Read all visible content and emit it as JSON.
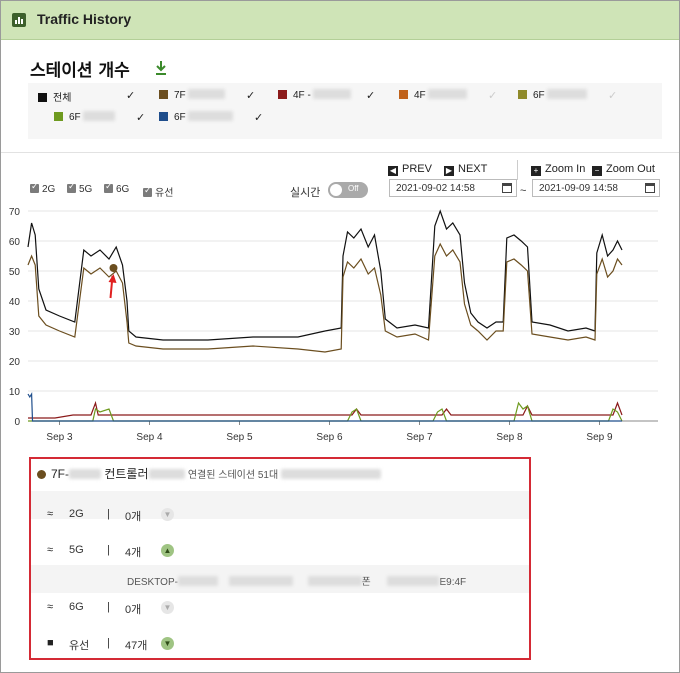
{
  "app": {
    "title": "Traffic History"
  },
  "section": {
    "title": "스테이션 개수"
  },
  "legend": [
    {
      "name": "전체",
      "color": "#111111",
      "checked": true
    },
    {
      "name": "7F",
      "color": "#6b4e1f",
      "checked": true,
      "blurred": true
    },
    {
      "name": "4F -",
      "color": "#8b1a1a",
      "checked": true,
      "blurred": true
    },
    {
      "name": "4F",
      "color": "#c0621b",
      "checked": false,
      "blurred": true
    },
    {
      "name": "6F",
      "color": "#8f8a2a",
      "checked": false,
      "blurred": true
    },
    {
      "name": "6F",
      "color": "#6e9a1f",
      "checked": true,
      "blurred": true
    },
    {
      "name": "6F",
      "color": "#1f4e8c",
      "checked": true,
      "blurred": true
    }
  ],
  "filters": {
    "bands": [
      "2G",
      "5G",
      "6G",
      "유선"
    ],
    "realtime_label": "실시간",
    "toggle": "Off"
  },
  "nav": {
    "prev": "PREV",
    "next": "NEXT",
    "zoom_in": "Zoom In",
    "zoom_out": "Zoom Out",
    "start": "2021-09-02 14:58",
    "end": "2021-09-09 14:58",
    "tilde": "~"
  },
  "chart_data": {
    "type": "line",
    "ylim": [
      0,
      70
    ],
    "yticks": [
      0,
      10,
      20,
      30,
      40,
      50,
      60,
      70
    ],
    "xlim": [
      0,
      7
    ],
    "xticks": [
      {
        "x": 0.35,
        "label": "Sep 3"
      },
      {
        "x": 1.35,
        "label": "Sep 4"
      },
      {
        "x": 2.35,
        "label": "Sep 5"
      },
      {
        "x": 3.35,
        "label": "Sep 6"
      },
      {
        "x": 4.35,
        "label": "Sep 7"
      },
      {
        "x": 5.35,
        "label": "Sep 8"
      },
      {
        "x": 6.35,
        "label": "Sep 9"
      }
    ],
    "grid": true,
    "marker": {
      "x": 0.95,
      "y": 51,
      "series": "7F"
    },
    "series": [
      {
        "name": "전체",
        "color": "#111111",
        "points": [
          [
            0,
            58
          ],
          [
            0.04,
            66
          ],
          [
            0.08,
            62
          ],
          [
            0.12,
            44
          ],
          [
            0.2,
            37
          ],
          [
            0.35,
            35
          ],
          [
            0.52,
            33
          ],
          [
            0.62,
            57
          ],
          [
            0.7,
            55
          ],
          [
            0.8,
            57
          ],
          [
            0.9,
            54
          ],
          [
            0.98,
            58
          ],
          [
            1.05,
            52
          ],
          [
            1.1,
            40
          ],
          [
            1.12,
            30
          ],
          [
            1.2,
            28
          ],
          [
            1.5,
            27
          ],
          [
            2,
            27
          ],
          [
            2.5,
            28
          ],
          [
            3,
            28
          ],
          [
            3.3,
            30
          ],
          [
            3.48,
            31
          ],
          [
            3.5,
            55
          ],
          [
            3.55,
            63
          ],
          [
            3.62,
            61
          ],
          [
            3.7,
            64
          ],
          [
            3.78,
            58
          ],
          [
            3.85,
            62
          ],
          [
            3.92,
            50
          ],
          [
            3.97,
            34
          ],
          [
            4.1,
            31
          ],
          [
            4.3,
            32
          ],
          [
            4.45,
            31
          ],
          [
            4.52,
            65
          ],
          [
            4.58,
            70
          ],
          [
            4.65,
            64
          ],
          [
            4.72,
            66
          ],
          [
            4.8,
            62
          ],
          [
            4.85,
            46
          ],
          [
            4.92,
            36
          ],
          [
            5,
            33
          ],
          [
            5.1,
            31
          ],
          [
            5.2,
            33
          ],
          [
            5.28,
            33
          ],
          [
            5.32,
            61
          ],
          [
            5.4,
            62
          ],
          [
            5.48,
            60
          ],
          [
            5.55,
            58
          ],
          [
            5.6,
            33
          ],
          [
            5.8,
            32
          ],
          [
            6,
            30
          ],
          [
            6.2,
            31
          ],
          [
            6.3,
            30
          ],
          [
            6.32,
            56
          ],
          [
            6.38,
            62
          ],
          [
            6.44,
            55
          ],
          [
            6.5,
            57
          ],
          [
            6.55,
            60
          ],
          [
            6.6,
            57
          ]
        ]
      },
      {
        "name": "7F",
        "color": "#6b4e1f",
        "points": [
          [
            0,
            52
          ],
          [
            0.04,
            55
          ],
          [
            0.08,
            52
          ],
          [
            0.12,
            35
          ],
          [
            0.2,
            32
          ],
          [
            0.35,
            30
          ],
          [
            0.52,
            28
          ],
          [
            0.62,
            51
          ],
          [
            0.7,
            49
          ],
          [
            0.8,
            51
          ],
          [
            0.9,
            48
          ],
          [
            0.98,
            50
          ],
          [
            1.05,
            46
          ],
          [
            1.1,
            33
          ],
          [
            1.12,
            26
          ],
          [
            1.2,
            25
          ],
          [
            1.5,
            24
          ],
          [
            2,
            24
          ],
          [
            2.5,
            25
          ],
          [
            3,
            24
          ],
          [
            3.3,
            23
          ],
          [
            3.48,
            24
          ],
          [
            3.5,
            48
          ],
          [
            3.55,
            53
          ],
          [
            3.62,
            51
          ],
          [
            3.7,
            54
          ],
          [
            3.78,
            49
          ],
          [
            3.85,
            51
          ],
          [
            3.92,
            42
          ],
          [
            3.97,
            30
          ],
          [
            4.1,
            28
          ],
          [
            4.3,
            29
          ],
          [
            4.45,
            27
          ],
          [
            4.52,
            55
          ],
          [
            4.58,
            59
          ],
          [
            4.65,
            55
          ],
          [
            4.72,
            57
          ],
          [
            4.8,
            53
          ],
          [
            4.85,
            39
          ],
          [
            4.92,
            32
          ],
          [
            5,
            30
          ],
          [
            5.1,
            27
          ],
          [
            5.2,
            30
          ],
          [
            5.28,
            30
          ],
          [
            5.32,
            53
          ],
          [
            5.4,
            54
          ],
          [
            5.48,
            52
          ],
          [
            5.55,
            50
          ],
          [
            5.6,
            29
          ],
          [
            5.8,
            28
          ],
          [
            6,
            27
          ],
          [
            6.2,
            28
          ],
          [
            6.3,
            27
          ],
          [
            6.32,
            49
          ],
          [
            6.38,
            54
          ],
          [
            6.44,
            48
          ],
          [
            6.5,
            50
          ],
          [
            6.55,
            54
          ],
          [
            6.6,
            52
          ]
        ]
      },
      {
        "name": "4F -",
        "color": "#8b1a1a",
        "points": [
          [
            0,
            1
          ],
          [
            0.3,
            1
          ],
          [
            0.5,
            2
          ],
          [
            0.7,
            2
          ],
          [
            0.75,
            6
          ],
          [
            0.78,
            2
          ],
          [
            1,
            2
          ],
          [
            2,
            2
          ],
          [
            3,
            2
          ],
          [
            3.6,
            2
          ],
          [
            3.65,
            4
          ],
          [
            3.7,
            2
          ],
          [
            4,
            2
          ],
          [
            4.6,
            2
          ],
          [
            4.65,
            4
          ],
          [
            4.7,
            2
          ],
          [
            5.5,
            2
          ],
          [
            5.55,
            5
          ],
          [
            5.6,
            2
          ],
          [
            6,
            2
          ],
          [
            6.5,
            2
          ],
          [
            6.55,
            6
          ],
          [
            6.6,
            2
          ]
        ]
      },
      {
        "name": "6F",
        "color": "#6e9a1f",
        "points": [
          [
            0,
            0
          ],
          [
            0.5,
            0
          ],
          [
            0.72,
            0
          ],
          [
            0.75,
            4
          ],
          [
            0.8,
            3
          ],
          [
            0.9,
            4
          ],
          [
            0.95,
            0
          ],
          [
            1.2,
            0
          ],
          [
            3,
            0
          ],
          [
            3.55,
            0
          ],
          [
            3.6,
            3
          ],
          [
            3.65,
            4
          ],
          [
            3.7,
            0
          ],
          [
            4.5,
            0
          ],
          [
            4.55,
            3
          ],
          [
            4.6,
            4
          ],
          [
            4.65,
            0
          ],
          [
            5.4,
            0
          ],
          [
            5.45,
            6
          ],
          [
            5.5,
            4
          ],
          [
            5.55,
            5
          ],
          [
            5.6,
            0
          ],
          [
            6,
            0
          ],
          [
            6.45,
            0
          ],
          [
            6.5,
            4
          ],
          [
            6.55,
            3
          ],
          [
            6.6,
            0
          ]
        ]
      },
      {
        "name": "6F",
        "color": "#1f4e8c",
        "points": [
          [
            0,
            9
          ],
          [
            0.02,
            8
          ],
          [
            0.04,
            9
          ],
          [
            0.05,
            0
          ],
          [
            6.6,
            0
          ]
        ]
      }
    ]
  },
  "detail": {
    "name": "7F-",
    "controller": "컨트롤러",
    "connected": "연결된 스테이션 51대",
    "rows": [
      {
        "icon": "wifi-icon",
        "band": "2G",
        "bar": "|",
        "count": "0개",
        "expanded": false
      },
      {
        "icon": "wifi-icon",
        "band": "5G",
        "bar": "|",
        "count": "4개",
        "expanded": true
      },
      {
        "client_prefix": "DESKTOP-",
        "client_suffix": "폰",
        "mac_tail": "E9:4F"
      },
      {
        "icon": "wifi-icon",
        "band": "6G",
        "bar": "|",
        "count": "0개",
        "expanded": false
      },
      {
        "icon": "monitor-icon",
        "band": "유선",
        "bar": "|",
        "count": "47개",
        "expanded": true
      }
    ]
  }
}
